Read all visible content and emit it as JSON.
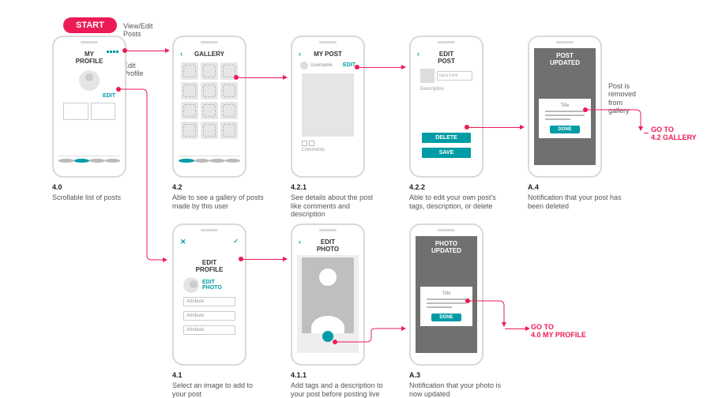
{
  "badge": "START",
  "side": {
    "viewedit": "View/Edit\nPosts",
    "editprofile": "Edit\nProfile",
    "removed": "Post is\nremoved\nfrom\ngallery"
  },
  "goto": {
    "gallery": "GO TO\n4.2 GALLERY",
    "profile": "GO TO\n4.0 MY PROFILE"
  },
  "screens": {
    "s40": {
      "title": "MY\nPROFILE",
      "edit": "EDIT"
    },
    "s42": {
      "title": "GALLERY"
    },
    "s421": {
      "title": "MY POST",
      "user": "Username",
      "edit": "EDIT",
      "comments": "Comments"
    },
    "s422": {
      "title": "EDIT\nPOST",
      "input": "Input Field",
      "desc": "Description",
      "delete": "DELETE",
      "save": "SAVE"
    },
    "sA4": {
      "title": "POST\nUPDATED",
      "card": "Title",
      "done": "DONE"
    },
    "s41": {
      "title": "EDIT\nPROFILE",
      "editphoto": "EDIT\nPHOTO",
      "attr": "Attribute"
    },
    "s411": {
      "title": "EDIT\nPHOTO"
    },
    "sA3": {
      "title": "PHOTO\nUPDATED",
      "card": "Title",
      "done": "DONE"
    }
  },
  "captions": {
    "c40": {
      "num": "4.0",
      "txt": "Scrollable list of posts"
    },
    "c42": {
      "num": "4.2",
      "txt": "Able to see a gallery of posts made by this user"
    },
    "c421": {
      "num": "4.2.1",
      "txt": "See details about the post like comments and description"
    },
    "c422": {
      "num": "4.2.2",
      "txt": "Able to edit your own post's tags, description, or delete"
    },
    "cA4": {
      "num": "A.4",
      "txt": "Notification that your post has been deleted"
    },
    "c41": {
      "num": "4.1",
      "txt": "Select an image to add to your post"
    },
    "c411": {
      "num": "4.1.1",
      "txt": "Add tags and a description to your post before posting live"
    },
    "cA3": {
      "num": "A.3",
      "txt": "Notification that your photo is now updated"
    }
  }
}
